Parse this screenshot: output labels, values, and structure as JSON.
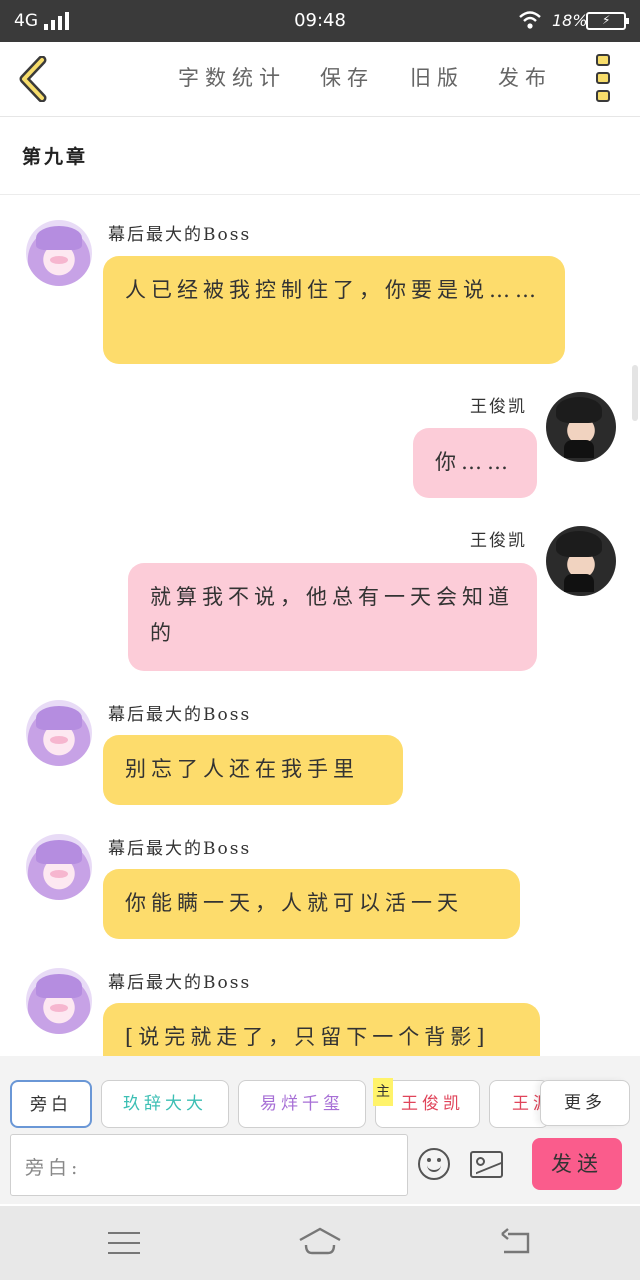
{
  "status_bar": {
    "network": "4G",
    "time": "09:48",
    "battery": "18%"
  },
  "toolbar": {
    "actions": [
      "字数统计",
      "保存",
      "旧版",
      "发布"
    ]
  },
  "chapter": {
    "title": "第九章"
  },
  "messages": [
    {
      "sender": "幕后最大的Boss",
      "side": "left",
      "avatar": "boss-avatar",
      "text": "人已经被我控制住了，你要是说……"
    },
    {
      "sender": "王俊凯",
      "side": "right",
      "avatar": "wang-junkai-avatar",
      "text": "你……"
    },
    {
      "sender": "王俊凯",
      "side": "right",
      "avatar": "wang-junkai-avatar",
      "text": "就算我不说，他总有一天会知道的"
    },
    {
      "sender": "幕后最大的Boss",
      "side": "left",
      "avatar": "boss-avatar",
      "text": "别忘了人还在我手里"
    },
    {
      "sender": "幕后最大的Boss",
      "side": "left",
      "avatar": "boss-avatar",
      "text": "你能瞒一天，人就可以活一天"
    },
    {
      "sender": "幕后最大的Boss",
      "side": "left",
      "avatar": "boss-avatar",
      "text": "[说完就走了，只留下一个背影]"
    }
  ],
  "roles": [
    {
      "label": "旁白",
      "color": "#333333",
      "active": true
    },
    {
      "label": "玖辞大大",
      "color": "#3cbfb4"
    },
    {
      "label": "易烊千玺",
      "color": "#a76fd6"
    },
    {
      "label": "王俊凯",
      "color": "#e0445a",
      "badge": "主"
    },
    {
      "label": "王源",
      "color": "#e0445a"
    }
  ],
  "more_roles_label": "更多",
  "input": {
    "label": "旁白:"
  },
  "send_label": "发送",
  "colors": {
    "accent_yellow": "#fddc6c",
    "bubble_pink": "#fcccd8",
    "send_pink": "#fa5c8c"
  }
}
